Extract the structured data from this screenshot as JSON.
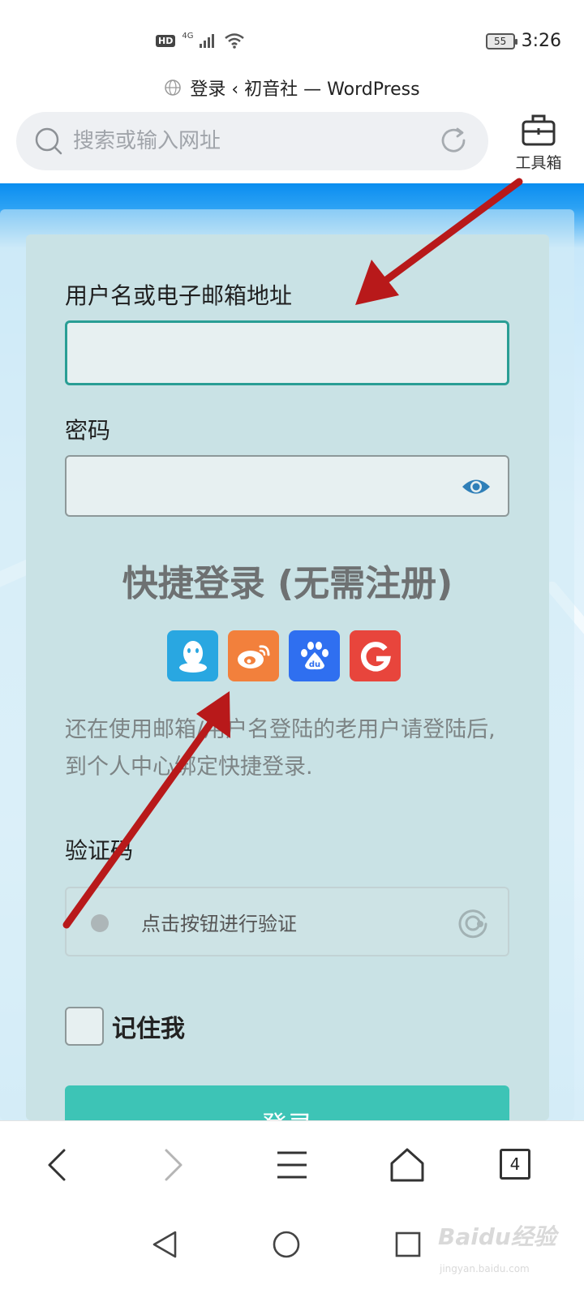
{
  "status_bar": {
    "hd": "HD",
    "network": "4G",
    "battery": "55",
    "time": "3:26"
  },
  "page": {
    "title": "登录 ‹ 初音社 — WordPress"
  },
  "address_bar": {
    "placeholder": "搜索或输入网址"
  },
  "toolbox": {
    "label": "工具箱",
    "icon": "toolbox-icon"
  },
  "form": {
    "username_label": "用户名或电子邮箱地址",
    "username_value": "",
    "password_label": "密码",
    "password_value": "",
    "quick_login_heading": "快捷登录 (无需注册)",
    "social_buttons": [
      {
        "name": "qq",
        "icon": "qq-icon",
        "color": "#29a7e1"
      },
      {
        "name": "weibo",
        "icon": "weibo-icon",
        "color": "#f2803c"
      },
      {
        "name": "baidu",
        "icon": "baidu-icon",
        "color": "#2f6ff0"
      },
      {
        "name": "google",
        "icon": "google-icon",
        "color": "#e8453c"
      }
    ],
    "info_text": "还在使用邮箱/用户名登陆的老用户请登陆后, 到个人中心绑定快捷登录.",
    "captcha_label": "验证码",
    "captcha_button_text": "点击按钮进行验证",
    "remember_label": "记住我",
    "remember_checked": false,
    "login_button": "登录"
  },
  "browser_bar": {
    "tab_count": "4"
  },
  "watermark": {
    "text": "Baidu经验",
    "sub": "jingyan.baidu.com"
  },
  "colors": {
    "accent": "#3dc4b6",
    "field_focus_border": "#2a9e95",
    "arrow": "#b8191a"
  }
}
